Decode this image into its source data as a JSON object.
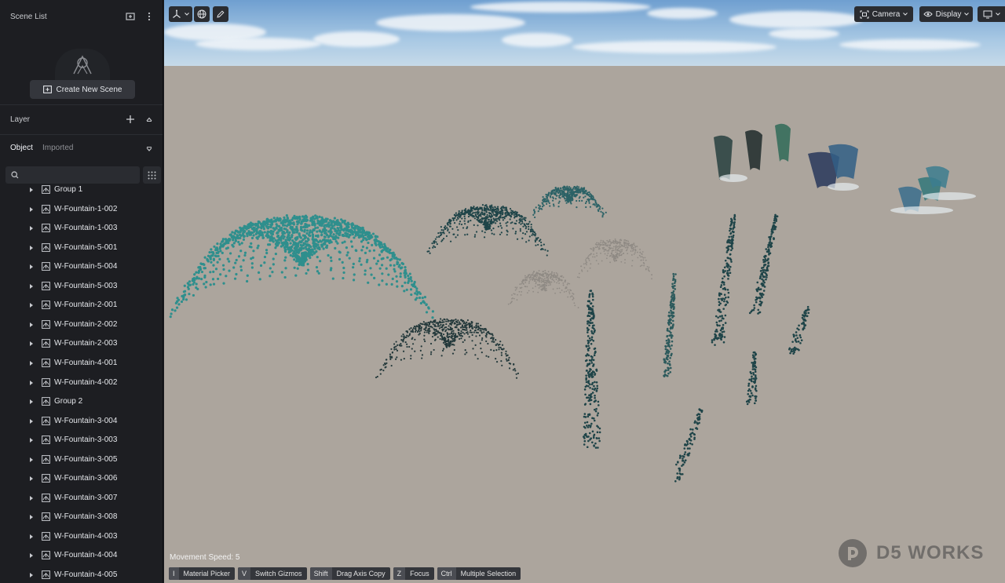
{
  "sidebar": {
    "scene_list_title": "Scene List",
    "create_scene_label": "Create New Scene",
    "layer_title": "Layer",
    "tabs": [
      {
        "label": "Object",
        "active": true
      },
      {
        "label": "Imported",
        "active": false
      }
    ],
    "search": {
      "placeholder": "",
      "value": ""
    },
    "layers": [
      {
        "label": "Group 1"
      },
      {
        "label": "W-Fountain-1-002"
      },
      {
        "label": "W-Fountain-1-003"
      },
      {
        "label": "W-Fountain-5-001"
      },
      {
        "label": "W-Fountain-5-004"
      },
      {
        "label": "W-Fountain-5-003"
      },
      {
        "label": "W-Fountain-2-001"
      },
      {
        "label": "W-Fountain-2-002"
      },
      {
        "label": "W-Fountain-2-003"
      },
      {
        "label": "W-Fountain-4-001"
      },
      {
        "label": "W-Fountain-4-002"
      },
      {
        "label": "Group 2"
      },
      {
        "label": "W-Fountain-3-004"
      },
      {
        "label": "W-Fountain-3-003"
      },
      {
        "label": "W-Fountain-3-005"
      },
      {
        "label": "W-Fountain-3-006"
      },
      {
        "label": "W-Fountain-3-007"
      },
      {
        "label": "W-Fountain-3-008"
      },
      {
        "label": "W-Fountain-4-003"
      },
      {
        "label": "W-Fountain-4-004"
      },
      {
        "label": "W-Fountain-4-005"
      }
    ]
  },
  "viewport": {
    "camera_label": "Camera",
    "display_label": "Display",
    "movement_speed_label": "Movement Speed: 5",
    "shortcuts": [
      {
        "key": "I",
        "label": "Material Picker"
      },
      {
        "key": "V",
        "label": "Switch Gizmos"
      },
      {
        "key": "Shift",
        "label": "Drag Axis Copy"
      },
      {
        "key": "Z",
        "label": "Focus"
      },
      {
        "key": "Ctrl",
        "label": "Multiple Selection"
      }
    ],
    "watermark_text": "D5 WORKS"
  },
  "colors": {
    "sidebar_bg": "#1d1e22",
    "ground": "#aca59d",
    "water_teal": "#2f8f8d",
    "water_dark": "#1f4448"
  }
}
